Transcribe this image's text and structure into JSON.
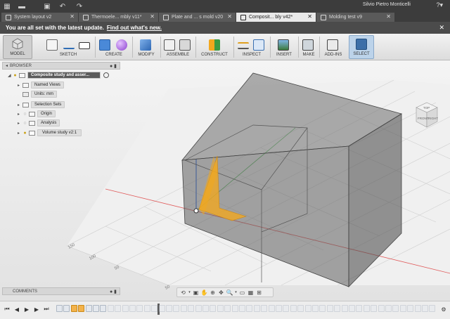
{
  "tabs": [
    {
      "label": "System layout v2",
      "active": false
    },
    {
      "label": "Thermoele... mbly v11*",
      "active": false
    },
    {
      "label": "Plate and ... s mold v20",
      "active": false
    },
    {
      "label": "Composit... bly v42*",
      "active": true
    },
    {
      "label": "Molding test v9",
      "active": false
    }
  ],
  "user": {
    "name": "Silvio Pietro Monticelli"
  },
  "notification": {
    "message": "You are all set with the latest update.",
    "link": "Find out what's new."
  },
  "toolbar": {
    "workspace": "MODEL",
    "groups": [
      "SKETCH",
      "CREATE",
      "MODIFY",
      "ASSEMBLE",
      "CONSTRUCT",
      "INSPECT",
      "INSERT",
      "MAKE",
      "ADD-INS",
      "SELECT"
    ]
  },
  "viewcube": {
    "faces": [
      "TOP",
      "FRONT",
      "RIGHT"
    ]
  },
  "browser": {
    "title": "BROWSER",
    "root": "Composite study and asser...",
    "items": [
      {
        "label": "Named Views"
      },
      {
        "label": "Units: mm"
      },
      {
        "label": "Selection Sets"
      },
      {
        "label": "Origin"
      },
      {
        "label": "Analysis"
      },
      {
        "label": "Volume study v2:1"
      }
    ]
  },
  "comments": {
    "title": "COMMENTS"
  },
  "grid_labels": [
    "150",
    "100",
    "50",
    "50"
  ],
  "colors": {
    "accent": "#f3a81e",
    "tab_bar": "#3c3c3c",
    "notification": "#4b4b4b",
    "x_axis": "#e03a3a",
    "y_axis": "#3a6fe0",
    "z_axis": "#2fae3a"
  }
}
